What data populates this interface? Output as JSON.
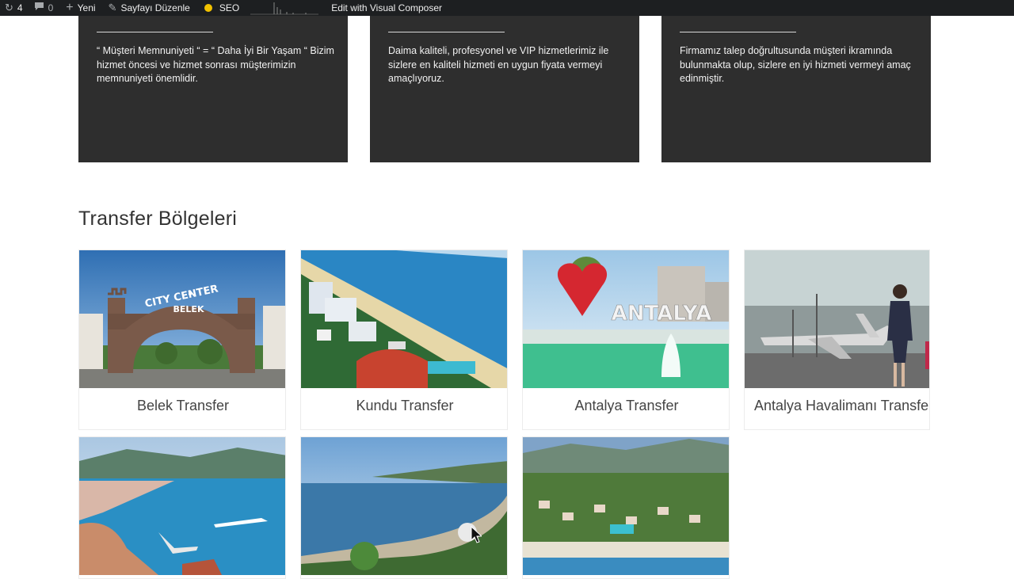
{
  "adminbar": {
    "updates_count": "4",
    "comments_count": "0",
    "new_label": "Yeni",
    "edit_page_label": "Sayfayı Düzenle",
    "seo_label": "SEO",
    "visual_composer_label": "Edit with Visual Composer",
    "seo_status_color": "#f2c200"
  },
  "features": [
    {
      "text": "“ Müşteri Memnuniyeti “ = “ Daha İyi Bir Yaşam “ Bizim hizmet öncesi ve hizmet sonrası müşterimizin memnuniyeti önemlidir."
    },
    {
      "text": "Daima kaliteli, profesyonel ve VIP hizmetlerimiz ile sizlere en kaliteli hizmeti en uygun fiyata vermeyi amaçlıyoruz."
    },
    {
      "text": "Firmamız talep doğrultusunda müşteri ikramında bulunmakta olup, sizlere en iyi hizmeti vermeyi amaç edinmiştir."
    }
  ],
  "section": {
    "title": "Transfer Bölgeleri"
  },
  "regions": [
    {
      "label": "Belek Transfer",
      "image": "belek-city-center-gate"
    },
    {
      "label": "Kundu Transfer",
      "image": "kundu-coast-hotels"
    },
    {
      "label": "Antalya Transfer",
      "image": "antalya-heart-sign"
    },
    {
      "label": "Antalya Havalimanı Transfer",
      "image": "airport-stewardess"
    },
    {
      "label": "",
      "image": "alanya-harbour"
    },
    {
      "label": "",
      "image": "kemer-bay"
    },
    {
      "label": "",
      "image": "resort-aerial"
    }
  ],
  "images": {
    "belek_sign_top": "CITY CENTER",
    "belek_sign_bottom": "BELEK",
    "antalya_sign": "ANTALYA"
  }
}
